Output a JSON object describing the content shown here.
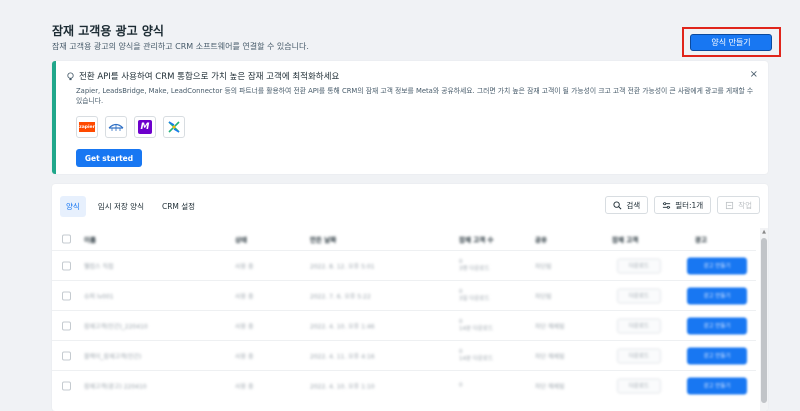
{
  "header": {
    "title": "잠재 고객용 광고 양식",
    "subtitle": "잠재 고객용 광고의 양식을 관리하고 CRM 소프트웨어를 연결할 수 있습니다.",
    "create_label": "양식 만들기"
  },
  "banner": {
    "title": "전환 API를 사용하여 CRM 통합으로 가치 높은 잠재 고객에 최적화하세요",
    "body": "Zapier, LeadsBridge, Make, LeadConnector 등의 파트너를 활용하여 전환 API를 통해 CRM의 잠재 고객 정보를 Meta와 공유하세요. 그러면 가치 높은 잠재 고객이 될 가능성이 크고 고객 전환 가능성이 큰 사람에게 광고를 게재할 수 있습니다.",
    "close_label": "×",
    "logos": [
      {
        "name": "zapier",
        "text": "zapier"
      },
      {
        "name": "leadsbridge",
        "text": ""
      },
      {
        "name": "make",
        "text": "M"
      },
      {
        "name": "leadconnector",
        "text": ""
      }
    ],
    "cta_label": "Get started",
    "accent": "#20a78b"
  },
  "tabs": [
    {
      "label": "양식",
      "active": true
    },
    {
      "label": "임시 저장 양식",
      "active": false
    },
    {
      "label": "CRM 설정",
      "active": false
    }
  ],
  "toolbar": {
    "search_label": "검색",
    "filter_label": "필터:1개",
    "action_label": "작업"
  },
  "table": {
    "headers": [
      "이름",
      "상태",
      "만든 날짜",
      "잠재 고객 수",
      "공유",
      "잠재 고객",
      "광고"
    ],
    "rows": [
      {
        "name": "웰컴스 직접",
        "status": "사용 중",
        "date": "2022. 8. 12. 오후 5:01",
        "leads_a": "0",
        "leads_b": "3명 다운로드",
        "share": "차단됨",
        "download": "다운로드",
        "ad": "광고 만들기"
      },
      {
        "name": "슈퍼 lv001",
        "status": "사용 중",
        "date": "2022. 7. 6. 오후 5:22",
        "leads_a": "0",
        "leads_b": "3일 다운로드",
        "share": "차단됨",
        "download": "다운로드",
        "ad": "광고 만들기"
      },
      {
        "name": "잠재고객(인간)_220410",
        "status": "사용 중",
        "date": "2022. 4. 10. 오후 1:46",
        "leads_a": "0",
        "leads_b": "14분 다운로드",
        "share": "차단 해제됨",
        "download": "다운로드",
        "ad": "광고 만들기"
      },
      {
        "name": "블랙이_잠재고객(인간)",
        "status": "사용 중",
        "date": "2022. 4. 11. 오후 4:16",
        "leads_a": "0",
        "leads_b": "14분 다운로드",
        "share": "차단 해제됨",
        "download": "다운로드",
        "ad": "광고 만들기"
      },
      {
        "name": "잠재고객(광고) 220410",
        "status": "사용 중",
        "date": "2022. 4. 10. 오후 1:10",
        "leads_a": "0",
        "leads_b": "",
        "share": "차단 해제됨",
        "download": "다운로드",
        "ad": "광고 만들기"
      }
    ]
  }
}
